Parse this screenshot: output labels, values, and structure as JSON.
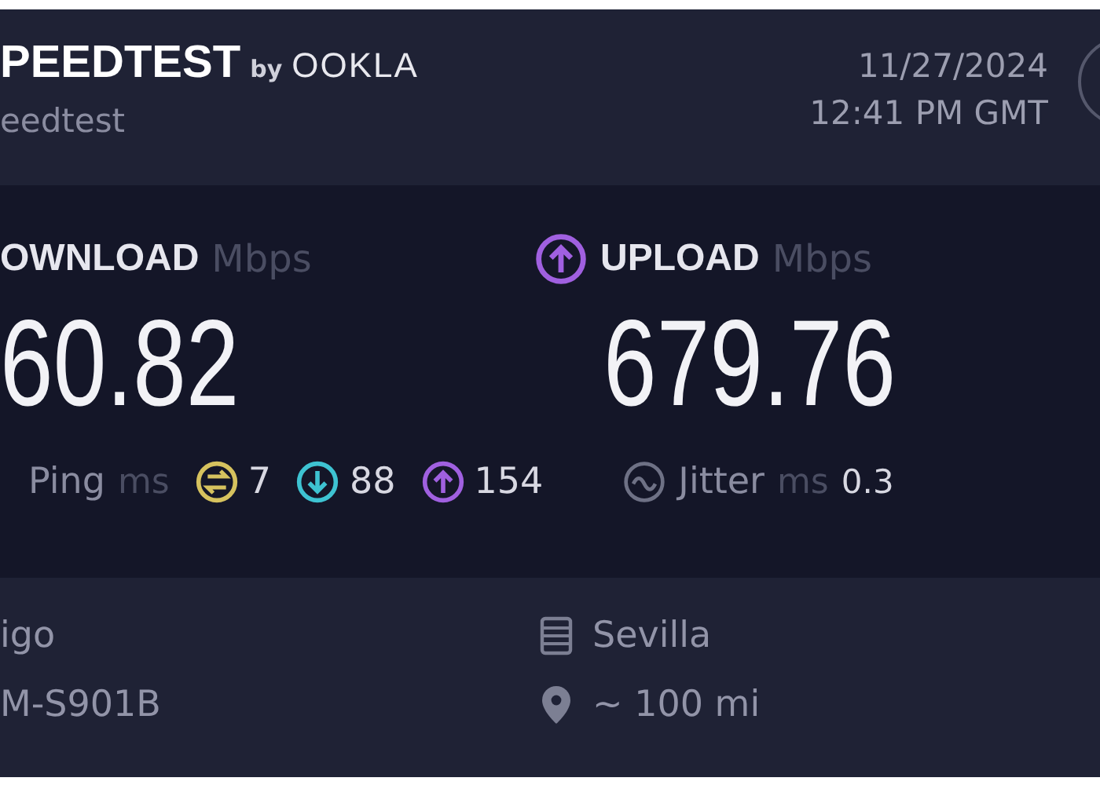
{
  "header": {
    "logo": "PEEDTEST",
    "logo_by": "by",
    "logo_brand": "OOKLA",
    "subtitle": "eedtest",
    "date": "11/27/2024",
    "time": "12:41 PM GMT"
  },
  "speeds": [
    {
      "kind": "download",
      "label": "OWNLOAD",
      "unit": "Mbps",
      "value": "60.82"
    },
    {
      "kind": "upload",
      "label": "UPLOAD",
      "unit": "Mbps",
      "value": "679.76"
    }
  ],
  "ping": {
    "label": "Ping",
    "unit": "ms",
    "values": [
      {
        "kind": "idle",
        "value": "7"
      },
      {
        "kind": "download",
        "value": "88"
      },
      {
        "kind": "upload",
        "value": "154"
      }
    ]
  },
  "jitter": {
    "label": "Jitter",
    "unit": "ms",
    "value": "0.3"
  },
  "provider": {
    "name": "igo",
    "device": "M-S901B"
  },
  "server": {
    "name": "Sevilla",
    "distance": "~ 100 mi"
  }
}
